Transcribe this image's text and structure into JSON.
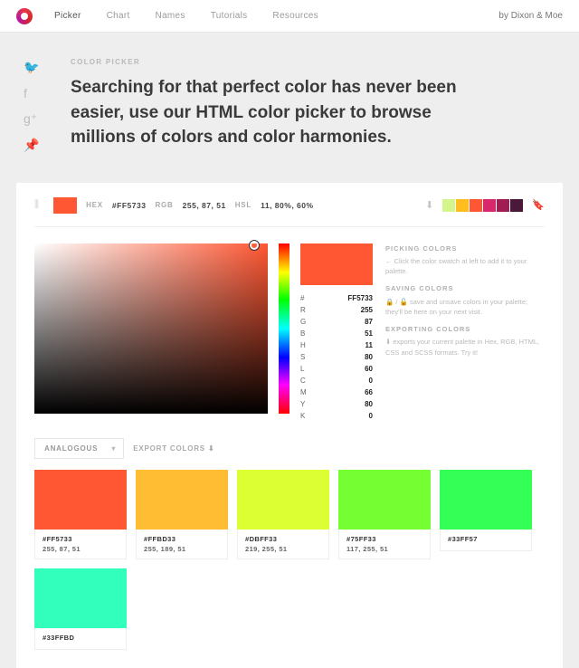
{
  "nav": {
    "items": [
      "Picker",
      "Chart",
      "Names",
      "Tutorials",
      "Resources"
    ],
    "credit": "by Dixon & Moe"
  },
  "hero": {
    "eyebrow": "COLOR PICKER",
    "headline": "Searching for that perfect color has never been easier, use our HTML color picker to browse millions of colors and color harmonies."
  },
  "toolbar": {
    "hex_label": "HEX",
    "hex": "#FF5733",
    "rgb_label": "RGB",
    "rgb": "255, 87, 51",
    "hsl_label": "HSL",
    "hsl": "11, 80%, 60%"
  },
  "palette": [
    "#d4f58c",
    "#ffbd1f",
    "#ff5733",
    "#d6286b",
    "#a01c52",
    "#4a1838"
  ],
  "readout": {
    "hash": "#",
    "hex": "FF5733",
    "r_l": "R",
    "r": "255",
    "g_l": "G",
    "g": "87",
    "b_l": "B",
    "b": "51",
    "h_l": "H",
    "h": "11",
    "s_l": "S",
    "s": "80",
    "l_l": "L",
    "l": "60",
    "c_l": "C",
    "c": "0",
    "m_l": "M",
    "m": "66",
    "y_l": "Y",
    "y": "80",
    "k_l": "K",
    "k": "0"
  },
  "help": {
    "t1": "PICKING COLORS",
    "d1": "← Click the color swatch at left to add it to your palette.",
    "t2": "SAVING COLORS",
    "d2": "🔒 / 🔓 save and unsave colors in your palette; they'll be here on your next visit.",
    "t3": "EXPORTING COLORS",
    "d3": "⬇ exports your current palette in Hex, RGB, HTML, CSS and SCSS formats. Try it!"
  },
  "harmony": {
    "mode": "ANALOGOUS",
    "export": "EXPORT COLORS"
  },
  "swatches": [
    {
      "hex": "#FF5733",
      "rgb": "255, 87, 51",
      "c": "#ff5733"
    },
    {
      "hex": "#FFBD33",
      "rgb": "255, 189, 51",
      "c": "#ffbd33"
    },
    {
      "hex": "#DBFF33",
      "rgb": "219, 255, 51",
      "c": "#dbff33"
    },
    {
      "hex": "#75FF33",
      "rgb": "117, 255, 51",
      "c": "#75ff33"
    },
    {
      "hex": "#33FF57",
      "rgb": "",
      "c": "#33ff57"
    },
    {
      "hex": "#33FFBD",
      "rgb": "",
      "c": "#33ffbd"
    }
  ]
}
